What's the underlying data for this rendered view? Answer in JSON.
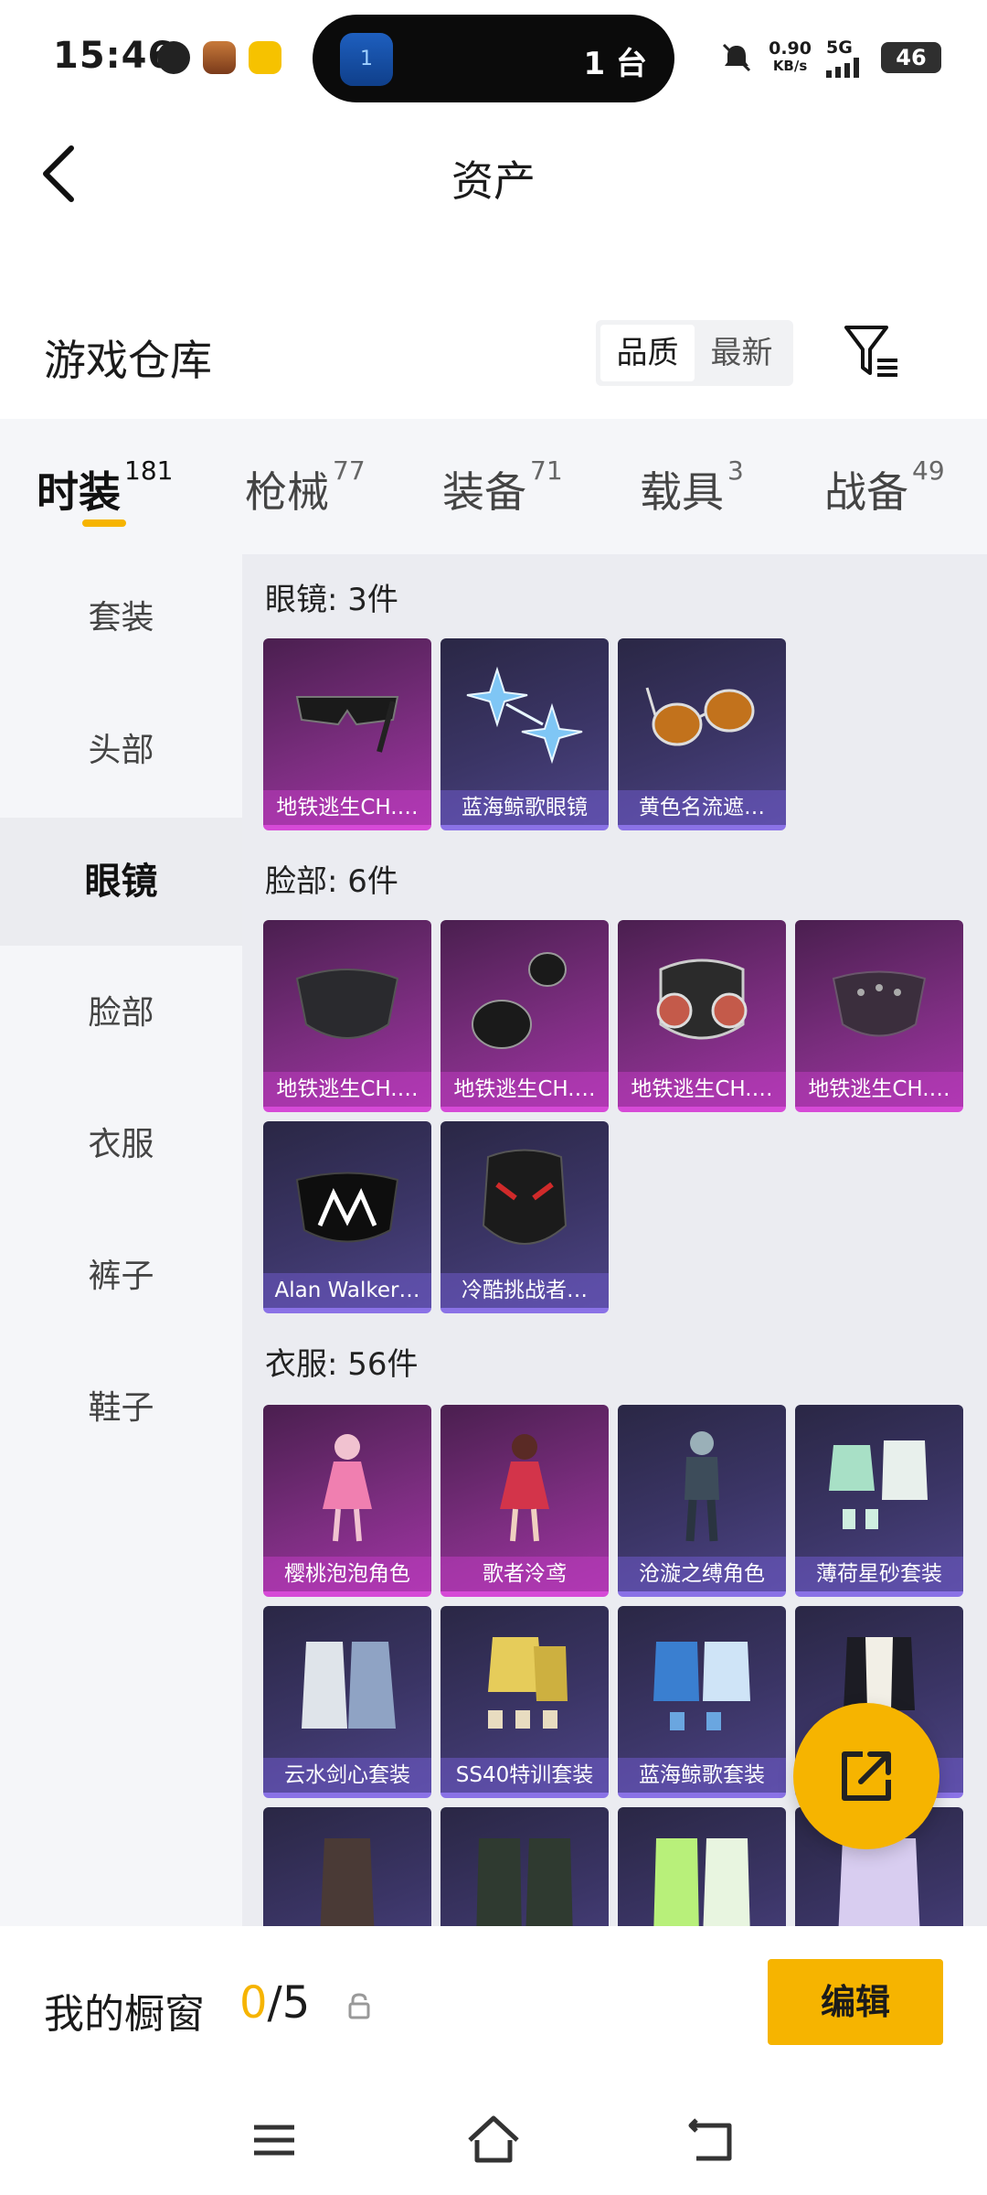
{
  "status_bar": {
    "time": "15:46",
    "island_badge": "1",
    "island_text": "1 台",
    "speed_value": "0.90",
    "speed_unit": "KB/s",
    "network": "5G",
    "battery": "46"
  },
  "header": {
    "title": "资产"
  },
  "warehouse": {
    "title": "游戏仓库",
    "sort_options": [
      "品质",
      "最新"
    ],
    "active_sort": "品质"
  },
  "tabs": [
    {
      "label": "时装",
      "count": "181",
      "active": true
    },
    {
      "label": "枪械",
      "count": "77"
    },
    {
      "label": "装备",
      "count": "71"
    },
    {
      "label": "载具",
      "count": "3"
    },
    {
      "label": "战备",
      "count": "49"
    }
  ],
  "sidebar": {
    "items": [
      "套装",
      "头部",
      "眼镜",
      "脸部",
      "衣服",
      "裤子",
      "鞋子"
    ],
    "active": "眼镜"
  },
  "groups": [
    {
      "title": "眼镜: 3件",
      "items": [
        {
          "name": "地铁逃生CH.…",
          "rarity": "purple",
          "icon": "sunglasses-icon"
        },
        {
          "name": "蓝海鲸歌眼镜",
          "rarity": "blue",
          "icon": "star-glasses-icon"
        },
        {
          "name": "黄色名流遮…",
          "rarity": "blue",
          "icon": "aviator-glasses-icon"
        }
      ]
    },
    {
      "title": "脸部: 6件",
      "items": [
        {
          "name": "地铁逃生CH.…",
          "rarity": "purple",
          "icon": "face-mask-icon"
        },
        {
          "name": "地铁逃生CH.…",
          "rarity": "purple",
          "icon": "neck-gaiter-icon"
        },
        {
          "name": "地铁逃生CH.…",
          "rarity": "purple",
          "icon": "gas-mask-icon"
        },
        {
          "name": "地铁逃生CH.…",
          "rarity": "purple",
          "icon": "studded-mask-icon"
        },
        {
          "name": "Alan Walker…",
          "rarity": "blue",
          "icon": "aw-mask-icon"
        },
        {
          "name": "冷酷挑战者…",
          "rarity": "blue",
          "icon": "full-face-mask-icon"
        }
      ]
    },
    {
      "title": "衣服: 56件",
      "items": [
        {
          "name": "樱桃泡泡角色",
          "rarity": "purple",
          "icon": "character-outfit-icon"
        },
        {
          "name": "歌者泠鸢",
          "rarity": "purple",
          "icon": "character-outfit-icon"
        },
        {
          "name": "沧漩之缚角色",
          "rarity": "blue",
          "icon": "character-outfit-icon"
        },
        {
          "name": "薄荷星砂套装",
          "rarity": "blue",
          "icon": "outfit-set-icon"
        },
        {
          "name": "云水剑心套装",
          "rarity": "blue",
          "icon": "outfit-set-icon"
        },
        {
          "name": "SS40特训套装",
          "rarity": "blue",
          "icon": "outfit-set-icon"
        },
        {
          "name": "蓝海鲸歌套装",
          "rarity": "blue",
          "icon": "outfit-set-icon"
        },
        {
          "name": "",
          "rarity": "blue",
          "icon": "outfit-set-icon"
        },
        {
          "name": "",
          "rarity": "blue",
          "icon": "outfit-set-icon"
        },
        {
          "name": "",
          "rarity": "blue",
          "icon": "outfit-set-icon"
        },
        {
          "name": "",
          "rarity": "blue",
          "icon": "outfit-set-icon"
        },
        {
          "name": "",
          "rarity": "blue",
          "icon": "outfit-set-icon"
        }
      ]
    }
  ],
  "showcase": {
    "label": "我的橱窗",
    "current": "0",
    "total": "/5",
    "edit_label": "编辑"
  },
  "colors": {
    "accent": "#f6b400",
    "purple_rarity": "#d64ad7",
    "blue_rarity": "#8a72e6"
  }
}
